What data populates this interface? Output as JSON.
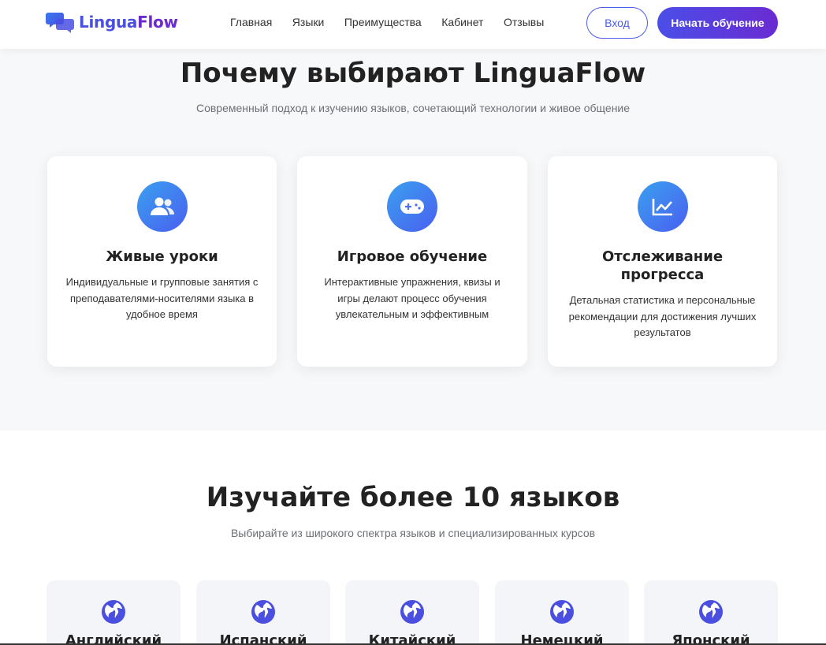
{
  "brand": {
    "part1": "Lingua",
    "part2": "Flow",
    "accent": "#4a4fe0",
    "accent2": "#6a2bd1"
  },
  "nav": {
    "items": [
      "Главная",
      "Языки",
      "Преимущества",
      "Кабинет",
      "Отзывы"
    ]
  },
  "header": {
    "login_label": "Вход",
    "start_label": "Начать обучение"
  },
  "why": {
    "title": "Почему выбирают LinguaFlow",
    "subtitle": "Современный подход к изучению языков, сочетающий технологии и живое общение",
    "cards": [
      {
        "icon": "users-icon",
        "title": "Живые уроки",
        "text": "Индивидуальные и групповые занятия с преподавателями-носителями языка в удобное время"
      },
      {
        "icon": "gamepad-icon",
        "title": "Игровое обучение",
        "text": "Интерактивные упражнения, квизы и игры делают процесс обучения увлекательным и эффективным"
      },
      {
        "icon": "chart-line-icon",
        "title": "Отслеживание прогресса",
        "text": "Детальная статистика и персональные рекомендации для достижения лучших результатов"
      }
    ]
  },
  "languages": {
    "title": "Изучайте более 10 языков",
    "subtitle": "Выбирайте из широкого спектра языков и специализированных курсов",
    "items": [
      {
        "icon": "globe-icon",
        "name": "Английский"
      },
      {
        "icon": "globe-icon",
        "name": "Испанский"
      },
      {
        "icon": "globe-icon",
        "name": "Китайский"
      },
      {
        "icon": "globe-icon",
        "name": "Немецкий"
      },
      {
        "icon": "globe-icon",
        "name": "Японский"
      }
    ]
  }
}
